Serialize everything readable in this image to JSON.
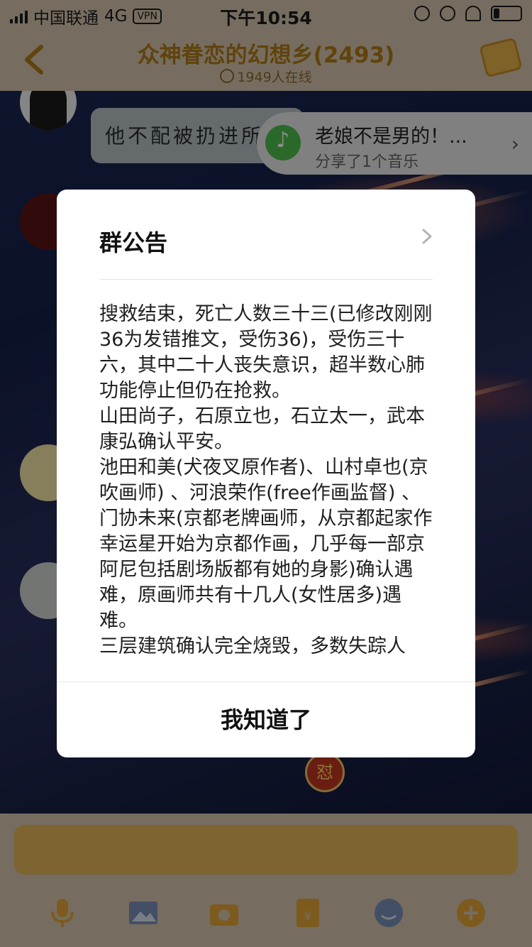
{
  "status_bar": {
    "carrier": "中国联通",
    "network": "4G",
    "vpn": "VPN",
    "time": "下午10:54"
  },
  "header": {
    "title": "众神眷恋的幻想乡(2493)",
    "online": "1949人在线"
  },
  "chat": {
    "bubble_text": "他不配被扔进所",
    "music_title": "老娘不是男的！...",
    "music_subtitle": "分享了1个音乐",
    "badge_char": "怼"
  },
  "modal": {
    "title": "群公告",
    "paragraphs": [
      "搜救结束，死亡人数三十三(已修改刚刚36为发错推文，受伤36)，受伤三十六，其中二十人丧失意识，超半数心肺功能停止但仍在抢救。",
      "山田尚子，石原立也，石立太一，武本康弘确认平安。",
      "池田和美(犬夜叉原作者)、山村卓也(京吹画师) 、河浪荣作(free作画监督) 、门协未来(京都老牌画师，从京都起家作幸运星开始为京都作画，几乎每一部京阿尼包括剧场版都有她的身影)确认遇难，原画师共有十几人(女性居多)遇难。",
      "三层建筑确认完全烧毁，多数失踪人"
    ],
    "confirm_label": "我知道了"
  },
  "colors": {
    "accent": "#b07a18",
    "header_bg": "#d8c7b0",
    "music_green": "#4fbf4f"
  },
  "icons": [
    "back-arrow-icon",
    "clock-icon",
    "headphones-icon",
    "battery-icon",
    "chevron-right-icon",
    "music-icon",
    "microphone-icon",
    "image-icon",
    "camera-icon",
    "red-packet-icon",
    "emoji-icon",
    "plus-icon"
  ]
}
